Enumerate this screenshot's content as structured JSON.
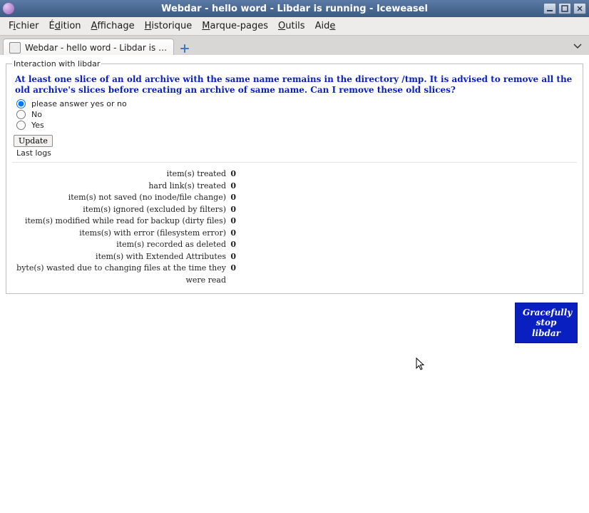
{
  "window": {
    "title": "Webdar - hello word - Libdar is running - Iceweasel"
  },
  "menu": {
    "fichier": {
      "pre": "F",
      "u": "i",
      "post": "chier"
    },
    "edition": {
      "pre": "É",
      "u": "d",
      "post": "ition"
    },
    "affichage": {
      "pre": "",
      "u": "A",
      "post": "ffichage"
    },
    "historique": {
      "pre": "",
      "u": "H",
      "post": "istorique"
    },
    "marquepages": {
      "pre": "",
      "u": "M",
      "post": "arque-pages"
    },
    "outils": {
      "pre": "",
      "u": "O",
      "post": "utils"
    },
    "aide": {
      "pre": "Aid",
      "u": "e",
      "post": ""
    }
  },
  "tab": {
    "label": "Webdar - hello word - Libdar is r…"
  },
  "page": {
    "legend": "Interaction with libdar",
    "question": "At least one slice of an old archive with the same name remains in the directory /tmp. It is advised to remove all the old archive's slices before creating an archive of same name. Can I remove these old slices?",
    "options": {
      "placeholder": "please answer yes or no",
      "no": "No",
      "yes": "Yes"
    },
    "update_label": "Update",
    "last_logs_label": "Last logs",
    "stats": [
      {
        "label": "item(s) treated",
        "value": "0"
      },
      {
        "label": "hard link(s) treated",
        "value": "0"
      },
      {
        "label": "item(s) not saved (no inode/file change)",
        "value": "0"
      },
      {
        "label": "item(s) ignored (excluded by filters)",
        "value": "0"
      },
      {
        "label": "item(s) modified while read for backup (dirty files)",
        "value": "0"
      },
      {
        "label": "items(s) with error (filesystem error)",
        "value": "0"
      },
      {
        "label": "item(s) recorded as deleted",
        "value": "0"
      },
      {
        "label": "item(s) with Extended Attributes",
        "value": "0"
      },
      {
        "label": "byte(s) wasted due to changing files at the time they were read",
        "value": "0"
      }
    ],
    "stop_label_line1": "Gracefully",
    "stop_label_line2": "stop libdar"
  }
}
